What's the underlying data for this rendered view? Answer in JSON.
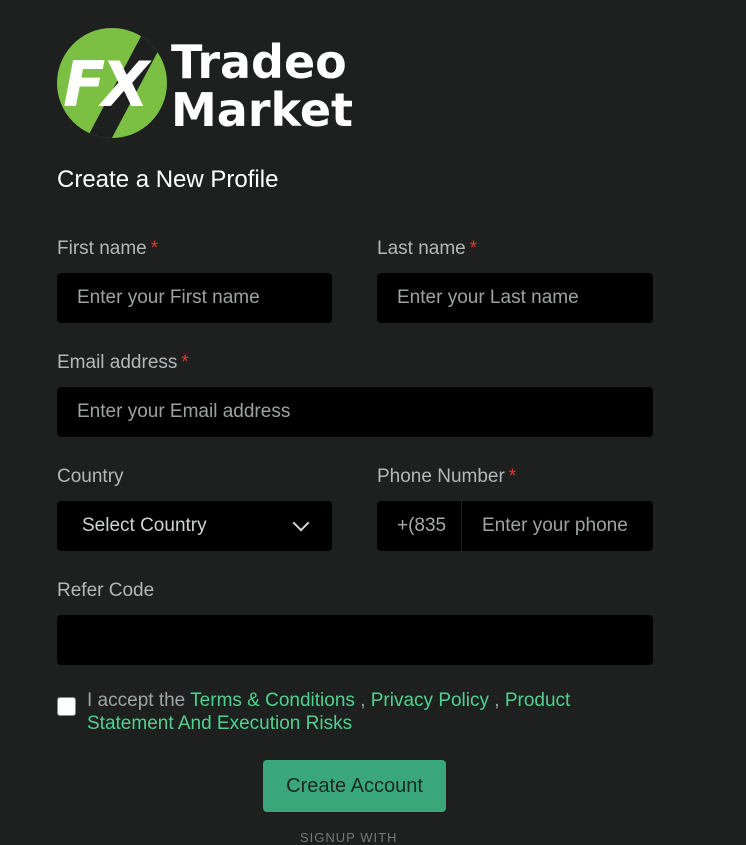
{
  "brand": {
    "logo_mark": "FX",
    "line1": "Tradeo",
    "line2": "Market"
  },
  "form": {
    "title": "Create a New Profile",
    "required_mark": "*",
    "first_name": {
      "label": "First name",
      "placeholder": "Enter your First name",
      "value": ""
    },
    "last_name": {
      "label": "Last name",
      "placeholder": "Enter your Last name",
      "value": ""
    },
    "email": {
      "label": "Email address",
      "placeholder": "Enter your Email address",
      "value": ""
    },
    "country": {
      "label": "Country",
      "selected": "Select Country"
    },
    "phone": {
      "label": "Phone Number",
      "prefix": "+(835",
      "placeholder": "Enter your phone",
      "value": ""
    },
    "refer_code": {
      "label": "Refer Code",
      "placeholder": "",
      "value": ""
    },
    "terms": {
      "checked": false,
      "prefix": "I accept the",
      "link_terms": "Terms & Conditions",
      "separator": ",",
      "link_privacy": "Privacy Policy",
      "link_product": "Product Statement And Execution Risks"
    },
    "submit_label": "Create Account",
    "footer_partial": "SIGNUP WITH"
  },
  "colors": {
    "background": "#1e2020",
    "field_bg": "#000000",
    "accent": "#4fd18e",
    "button": "#3aa77a",
    "required": "#e33434"
  }
}
